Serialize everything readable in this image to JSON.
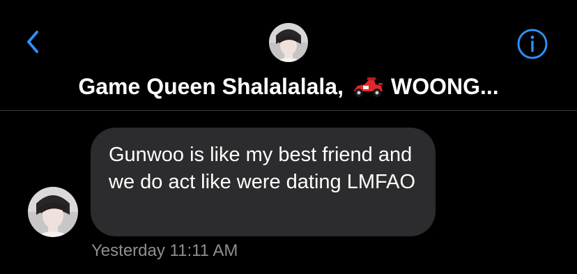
{
  "header": {
    "back_icon": "chevron-left-icon",
    "avatar_icon": "group-avatar",
    "info_icon": "info-icon",
    "title_left": "Game Queen Shalalalala,",
    "title_icon": "race-car-icon",
    "title_right": "WOONG..."
  },
  "conversation": {
    "messages": [
      {
        "sender_avatar": "contact-avatar",
        "text": "Gunwoo is like my best friend and we do act like were dating LMFAO",
        "timestamp": "Yesterday 11:11 AM"
      }
    ]
  },
  "colors": {
    "background": "#000000",
    "accent": "#2f8ff7",
    "bubble": "#2c2c2e",
    "timestamp": "#8e8e93",
    "divider": "#3a3a3c"
  }
}
